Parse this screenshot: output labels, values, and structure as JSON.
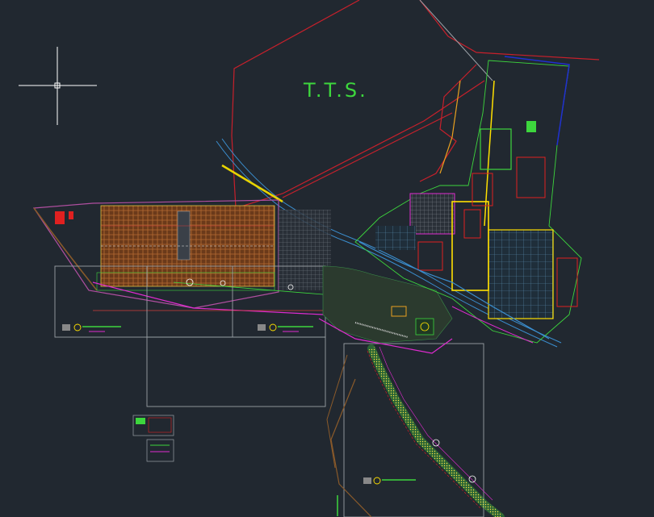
{
  "drawing": {
    "site_label": "T.T.S.",
    "colors": {
      "background": "#212830",
      "boundary": "#c8202b",
      "label": "#3dd63d",
      "frame": "#9aa0a6"
    }
  },
  "cursor": {
    "icon": "crosshair-icon"
  }
}
